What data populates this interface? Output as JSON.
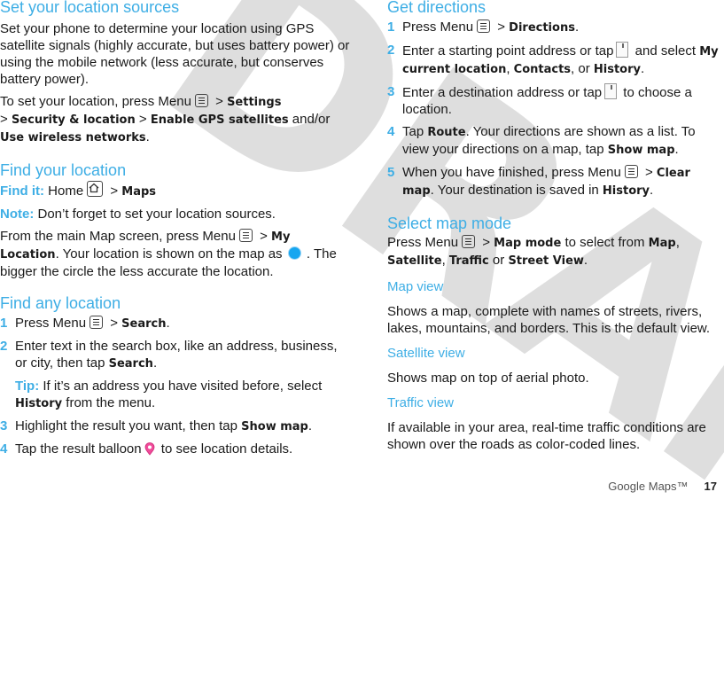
{
  "watermark": "DRAFT",
  "left": {
    "set_sources": {
      "title": "Set your location sources",
      "p1": "Set your phone to determine your location using GPS satellite signals (highly accurate, but uses battery power) or using the mobile network (less accurate, but conserves battery power).",
      "p2_a": "To set your location, press Menu",
      "p2_b": " > ",
      "p2_settings": "Settings",
      "p2_c": ">",
      "p2_security": "Security & location",
      "p2_d": " > ",
      "p2_gps": "Enable GPS satellites",
      "p2_e": " and/or ",
      "p2_wireless": "Use wireless networks",
      "p2_f": "."
    },
    "find_your": {
      "title": "Find your location",
      "findit_label": "Find it:",
      "findit_home": " Home",
      "findit_sep": " > ",
      "findit_maps": "Maps",
      "note_label": "Note:",
      "note_text": " Don’t forget to set your location sources.",
      "p_a": "From the main Map screen, press Menu",
      "p_b": " > ",
      "p_myloc": "My Location",
      "p_c": ". Your location is shown on the map as",
      "p_d": " . The bigger the circle the less accurate the location."
    },
    "find_any": {
      "title": "Find any location",
      "step1_num": "1",
      "step1_a": "Press Menu",
      "step1_b": " > ",
      "step1_search": "Search",
      "step1_c": ".",
      "step2_num": "2",
      "step2_a": "Enter text in the search box, like an address, business, or city, then tap ",
      "step2_search": "Search",
      "step2_b": ".",
      "tip_label": "Tip:",
      "tip_a": " If it’s an address you have visited before, select ",
      "tip_history": "History",
      "tip_b": " from the menu.",
      "step3_num": "3",
      "step3_a": "Highlight the result you want, then tap ",
      "step3_show": "Show map",
      "step3_b": ".",
      "step4_num": "4",
      "step4_a": "Tap the result balloon",
      "step4_b": " to see location details."
    }
  },
  "right": {
    "directions": {
      "title": "Get directions",
      "s1_num": "1",
      "s1_a": "Press Menu",
      "s1_b": " > ",
      "s1_dir": "Directions",
      "s1_c": ".",
      "s2_num": "2",
      "s2_a": "Enter a starting point address or tap",
      "s2_b": " and select ",
      "s2_mycur": "My current location",
      "s2_c": ", ",
      "s2_contacts": "Contacts",
      "s2_d": ", or ",
      "s2_history": "History",
      "s2_e": ".",
      "s3_num": "3",
      "s3_a": "Enter a destination address or tap",
      "s3_b": " to choose a location.",
      "s4_num": "4",
      "s4_a": "Tap ",
      "s4_route": "Route",
      "s4_b": ". Your directions are shown as a list. To view your directions on a map, tap ",
      "s4_show": "Show map",
      "s4_c": ".",
      "s5_num": "5",
      "s5_a": "When you have finished, press Menu",
      "s5_b": " > ",
      "s5_clear": "Clear map",
      "s5_c": ". Your destination is saved in ",
      "s5_history": "History",
      "s5_d": "."
    },
    "map_mode": {
      "title": "Select map mode",
      "p_a": "Press Menu",
      "p_b": " > ",
      "p_mode": "Map mode",
      "p_c": " to select from ",
      "p_map": "Map",
      "p_d": ", ",
      "p_sat": "Satellite",
      "p_e": ", ",
      "p_traffic": "Traffic",
      "p_f": " or ",
      "p_street": "Street View",
      "p_g": "."
    },
    "map_view": {
      "title": "Map view",
      "text": "Shows a map, complete with names of streets, rivers, lakes, mountains, and borders. This is the default view."
    },
    "satellite_view": {
      "title": "Satellite view",
      "text": "Shows map on top of aerial photo."
    },
    "traffic_view": {
      "title": "Traffic view",
      "text": "If available in your area, real-time traffic conditions are shown over the roads as color-coded lines."
    }
  },
  "footer": {
    "section": "Google Maps™",
    "page": "17"
  },
  "icons": {
    "menu": "menu-key-icon",
    "home": "home-key-icon",
    "location_dot": "location-dot-icon",
    "balloon": "result-balloon-icon",
    "contacts_picker": "bookmark-picker-icon"
  }
}
